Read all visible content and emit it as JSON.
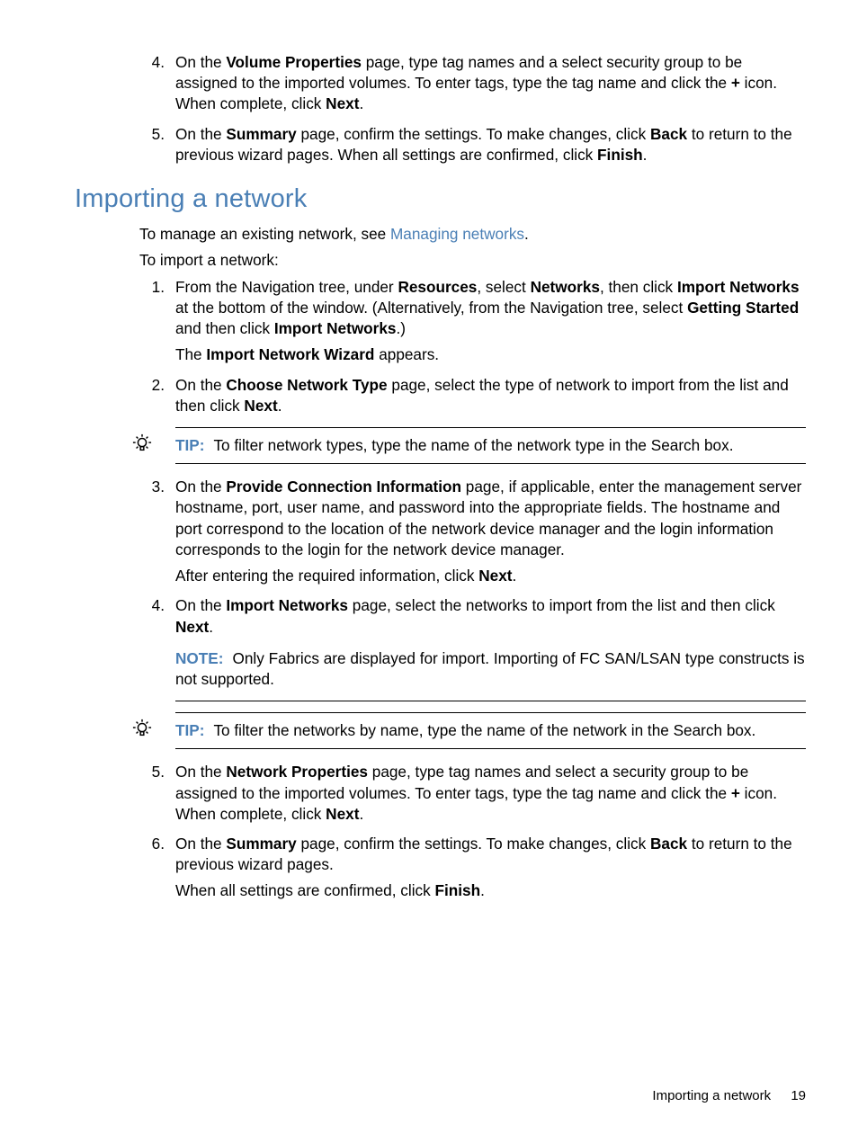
{
  "list1": {
    "i4": {
      "marker": "4.",
      "pre": "On the ",
      "b1": "Volume Properties",
      "mid1": " page, type tag names and a select security group to be assigned to the imported volumes. To enter tags, type the tag name and click the ",
      "b2": "+",
      "mid2": " icon. When complete, click ",
      "b3": "Next",
      "post": "."
    },
    "i5": {
      "marker": "5.",
      "pre": "On the ",
      "b1": "Summary",
      "mid1": " page, confirm the settings. To make changes, click ",
      "b2": "Back",
      "mid2": " to return to the previous wizard pages. When all settings are confirmed, click ",
      "b3": "Finish",
      "post": "."
    }
  },
  "heading": "Importing a network",
  "intro": {
    "pre": "To manage an existing network, see ",
    "link": "Managing networks",
    "post": "."
  },
  "intro2": "To import a network:",
  "list2": {
    "i1": {
      "marker": "1.",
      "pre": "From the Navigation tree, under ",
      "b1": "Resources",
      "mid1": ", select ",
      "b2": "Networks",
      "mid2": ", then click ",
      "b3": "Import Networks",
      "mid3": " at the bottom of the window. (Alternatively, from the Navigation tree, select ",
      "b4": "Getting Started",
      "mid4": " and then click ",
      "b5": "Import Networks",
      "post": ".)",
      "sub_pre": "The ",
      "sub_b": "Import Network Wizard",
      "sub_post": " appears."
    },
    "i2": {
      "marker": "2.",
      "pre": "On the ",
      "b1": "Choose Network Type",
      "mid1": " page, select the type of network to import from the list and then click ",
      "b2": "Next",
      "post": "."
    },
    "i3": {
      "marker": "3.",
      "pre": "On the ",
      "b1": "Provide Connection Information",
      "mid1": " page, if applicable, enter the management server hostname, port, user name, and password into the appropriate fields. The hostname and port correspond to the location of the network device manager and the login information corresponds to the login for the network device manager.",
      "sub_pre": "After entering the required information, click ",
      "sub_b": "Next",
      "sub_post": "."
    },
    "i4": {
      "marker": "4.",
      "pre": "On the ",
      "b1": "Import Networks",
      "mid1": " page, select the networks to import from the list and then click ",
      "b2": "Next",
      "post": "."
    },
    "i5": {
      "marker": "5.",
      "pre": "On the ",
      "b1": "Network Properties",
      "mid1": " page, type tag names and select a security group to be assigned to the imported volumes. To enter tags, type the tag name and click the ",
      "b2": "+",
      "mid2": " icon. When complete, click ",
      "b3": "Next",
      "post": "."
    },
    "i6": {
      "marker": "6.",
      "pre": "On the ",
      "b1": "Summary",
      "mid1": " page, confirm the settings. To make changes, click ",
      "b2": "Back",
      "mid2": " to return to the previous wizard pages.",
      "sub_pre": "When all settings are confirmed, click ",
      "sub_b": "Finish",
      "sub_post": "."
    }
  },
  "tip1": {
    "label": "TIP:",
    "text": "To filter network types, type the name of the network type in the Search box."
  },
  "note1": {
    "label": "NOTE:",
    "text": "Only Fabrics are displayed for import. Importing of FC SAN/LSAN type constructs is not supported."
  },
  "tip2": {
    "label": "TIP:",
    "text": "To filter the networks by name, type the name of the network in the Search box."
  },
  "footer": {
    "title": "Importing a network",
    "page": "19"
  }
}
